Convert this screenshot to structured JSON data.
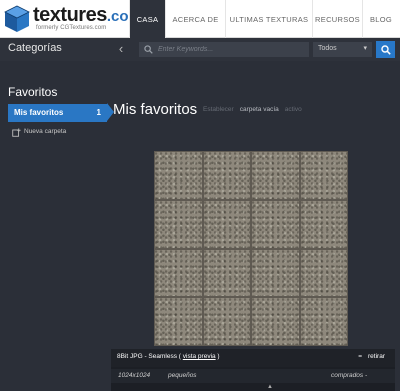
{
  "brand": {
    "name": "textures",
    "tld": ".com",
    "tagline": "formerly CGTextures.com",
    "colors": {
      "blue": "#2a6fb8",
      "accent": "#2a77c4",
      "dark": "#2e323b"
    }
  },
  "nav": {
    "items": [
      {
        "label": "CASA",
        "active": true
      },
      {
        "label": "ACERCA DE",
        "active": false
      },
      {
        "label": "ULTIMAS TEXTURAS",
        "active": false
      },
      {
        "label": "RECURSOS",
        "active": false
      },
      {
        "label": "BLOG",
        "active": false
      }
    ]
  },
  "catbar": {
    "title": "Categorías",
    "collapse_glyph": "‹",
    "search_placeholder": "Enter Keywords...",
    "filter_value": "Todos",
    "filter_caret": "▾"
  },
  "sidebar": {
    "title": "Favoritos",
    "items": [
      {
        "label": "Mis favoritos",
        "count": "1"
      }
    ],
    "new_folder_label": "Nueva carpeta"
  },
  "main": {
    "title": "Mis favoritos",
    "actions": [
      {
        "label": "Establecer",
        "enabled": false
      },
      {
        "label": "carpeta vacía",
        "enabled": true
      },
      {
        "label": "activo",
        "enabled": false
      }
    ],
    "card": {
      "format_prefix": "8Bit JPG - Seamless ( ",
      "preview_link": "vista previa",
      "format_suffix": " )",
      "remove_minus": "=",
      "remove_label": "retirar",
      "resolution": "1024x1024",
      "size": "pequeños",
      "status": "comprados -",
      "scroll_caret": "▲"
    }
  }
}
